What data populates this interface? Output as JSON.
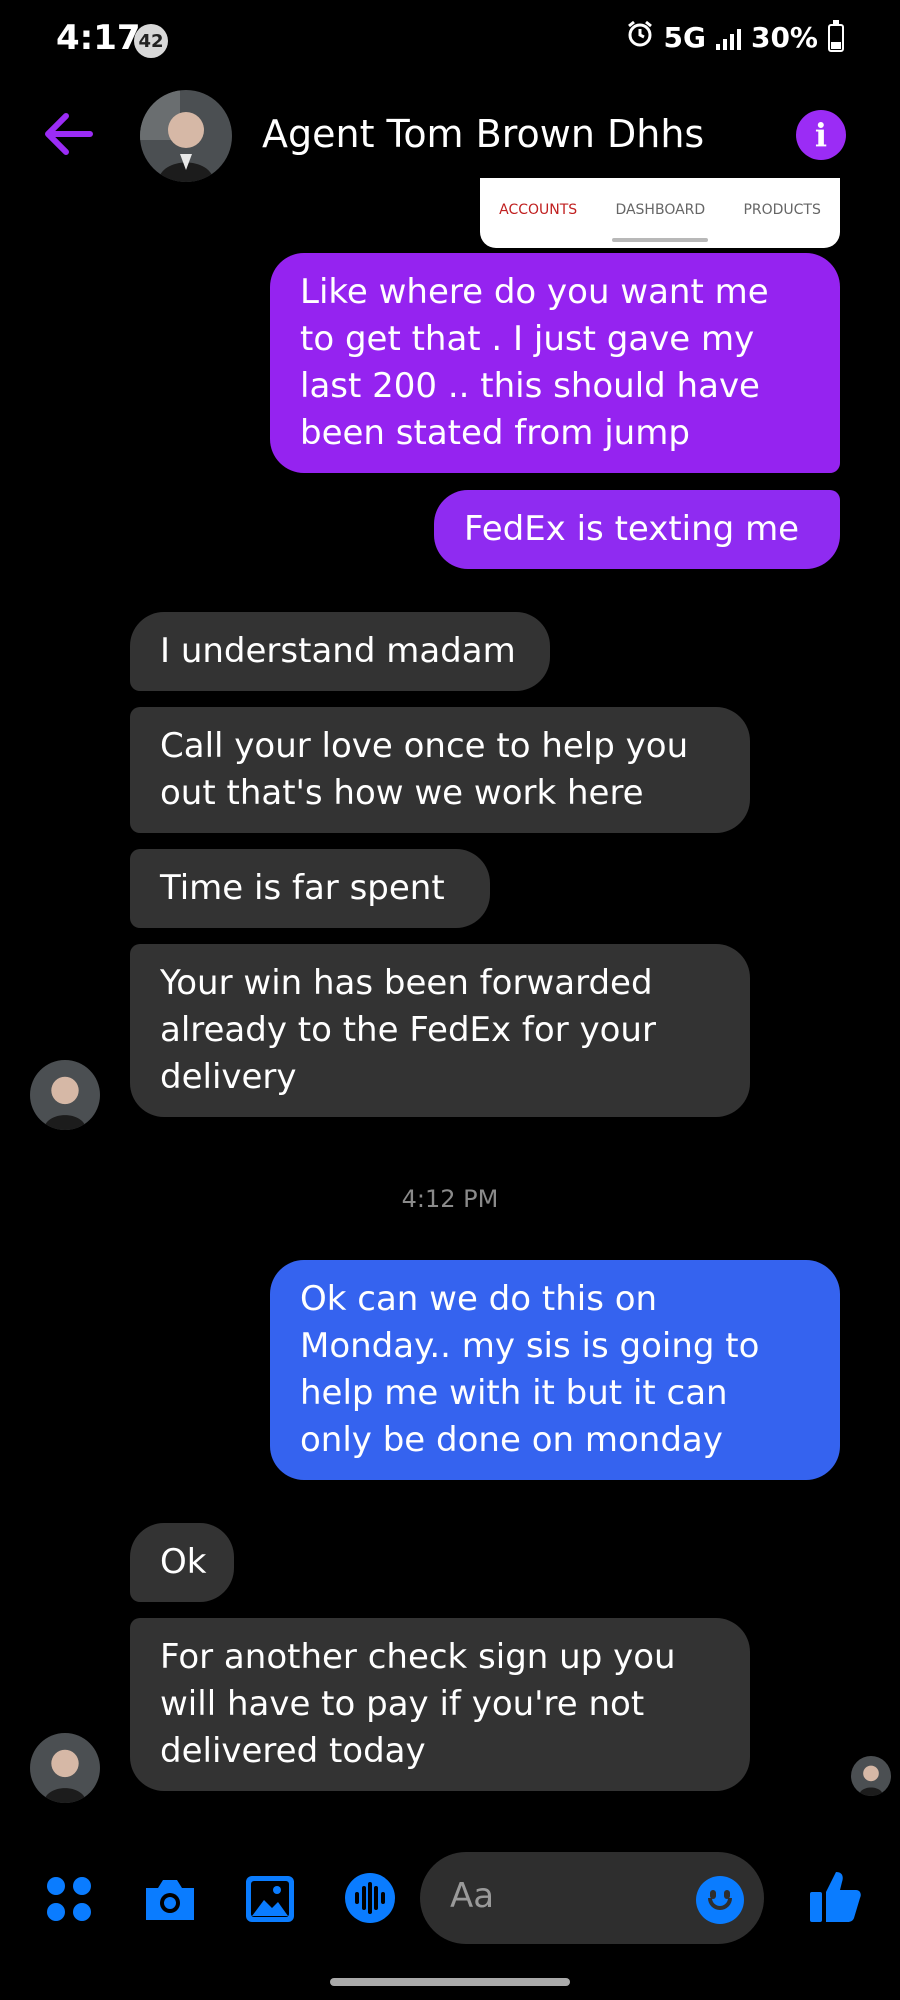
{
  "status_bar": {
    "time": "4:17",
    "notification_count": "42",
    "network": "5G",
    "battery": "30%"
  },
  "header": {
    "contact_name": "Agent Tom Brown Dhhs",
    "accent_color": "#9b2cf5"
  },
  "shared_card": {
    "tabs": [
      "ACCOUNTS",
      "DASHBOARD",
      "PRODUCTS"
    ]
  },
  "messages": [
    {
      "sender": "me",
      "text": "Like where do you want me to get that . I just gave my last 200 .. this should have been stated from jump"
    },
    {
      "sender": "me",
      "text": "FedEx is texting me"
    },
    {
      "sender": "them",
      "text": "I understand madam"
    },
    {
      "sender": "them",
      "text": "Call your love once to help you out that's how we work here"
    },
    {
      "sender": "them",
      "text": "Time is far spent"
    },
    {
      "sender": "them",
      "text": "Your win has been forwarded already to the FedEx for your delivery"
    },
    {
      "sender": "me",
      "text": "Ok can we do this on Monday.. my sis is going to help me with it but it can only be done on monday"
    },
    {
      "sender": "them",
      "text": "Ok"
    },
    {
      "sender": "them",
      "text": "For another check sign up you will have to pay if you're not delivered today"
    }
  ],
  "timestamp": "4:12 PM",
  "composer": {
    "placeholder": "Aa"
  },
  "icons": [
    "back-arrow-icon",
    "info-icon",
    "apps-icon",
    "camera-icon",
    "gallery-icon",
    "voice-icon",
    "emoji-icon",
    "thumbs-up-icon"
  ],
  "colors": {
    "sent_purple": "#9523f0",
    "sent_blue": "#3563ef",
    "received": "#333333",
    "action_blue": "#0a7cff"
  }
}
